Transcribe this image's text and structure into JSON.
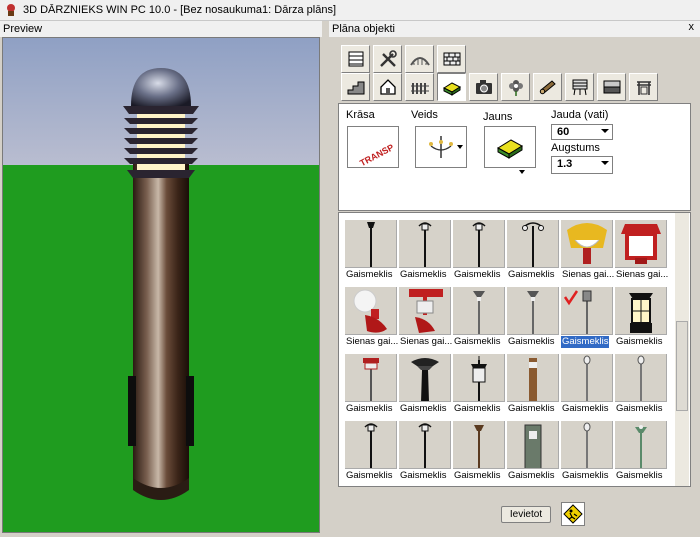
{
  "window": {
    "title": "3D DĀRZNIEKS WIN PC 10.0 - [Bez nosaukuma1: Dārza plāns]"
  },
  "preview": {
    "title": "Preview"
  },
  "objects": {
    "title": "Plāna objekti",
    "close": "x",
    "toolbar_row1": [
      "table-icon",
      "tools-icon",
      "bridge-icon",
      "brick-wall-icon"
    ],
    "toolbar_row2": [
      "stairs-icon",
      "house-icon",
      "fence-icon",
      "garden-light-icon",
      "camera-icon",
      "flower-icon",
      "log-icon",
      "grill-icon",
      "surface-icon",
      "pergola-icon"
    ],
    "props": {
      "color_label": "Krāsa",
      "color_preview_text": "TRANSP",
      "type_label": "Veids",
      "new_label": "Jauns",
      "power_label": "Jauda (vati)",
      "power_value": "60",
      "height_label": "Augstums",
      "height_value": "1.3"
    },
    "grid": [
      {
        "label": "Gaismeklis",
        "kind": "black-pole"
      },
      {
        "label": "Gaismeklis",
        "kind": "black-pole-ornate"
      },
      {
        "label": "Gaismeklis",
        "kind": "black-pole-ornate"
      },
      {
        "label": "Gaismeklis",
        "kind": "black-pole-double"
      },
      {
        "label": "Sienas gai...",
        "kind": "yellow-wall"
      },
      {
        "label": "Sienas gai...",
        "kind": "red-wall"
      },
      {
        "label": "Sienas gai...",
        "kind": "red-globe"
      },
      {
        "label": "Sienas gai...",
        "kind": "red-bracket"
      },
      {
        "label": "Gaismeklis",
        "kind": "grey-lamp"
      },
      {
        "label": "Gaismeklis",
        "kind": "grey-lamp"
      },
      {
        "label": "Gaismeklis",
        "kind": "bollard-selected",
        "selected": true
      },
      {
        "label": "Gaismeklis",
        "kind": "black-lantern"
      },
      {
        "label": "Gaismeklis",
        "kind": "red-bollard"
      },
      {
        "label": "Gaismeklis",
        "kind": "black-dome"
      },
      {
        "label": "Gaismeklis",
        "kind": "lantern-post"
      },
      {
        "label": "Gaismeklis",
        "kind": "wood-post"
      },
      {
        "label": "Gaismeklis",
        "kind": "thin-pole"
      },
      {
        "label": "Gaismeklis",
        "kind": "thin-pole"
      },
      {
        "label": "Gaismeklis",
        "kind": "black-pole-ornate"
      },
      {
        "label": "Gaismeklis",
        "kind": "black-pole-ornate"
      },
      {
        "label": "Gaismeklis",
        "kind": "brown-pole"
      },
      {
        "label": "Gaismeklis",
        "kind": "stone-pillar"
      },
      {
        "label": "Gaismeklis",
        "kind": "thin-pole"
      },
      {
        "label": "Gaismeklis",
        "kind": "green-pole"
      },
      {
        "label": "",
        "kind": "wood-post"
      },
      {
        "label": "",
        "kind": "thin-pole"
      },
      {
        "label": "",
        "kind": "lantern-post"
      },
      {
        "label": "",
        "kind": "metal-disc"
      },
      {
        "label": "",
        "kind": "metal-disc"
      },
      {
        "label": "",
        "kind": "metal-disc"
      }
    ],
    "bottom": {
      "place_label": "Ievietot",
      "sign_icon": "road-work-icon"
    }
  },
  "colors": {
    "sky_top": "#8fa0c4",
    "sky_bottom": "#b9bdd0",
    "grass": "#1f9c1f",
    "selection": "#316ac5"
  }
}
